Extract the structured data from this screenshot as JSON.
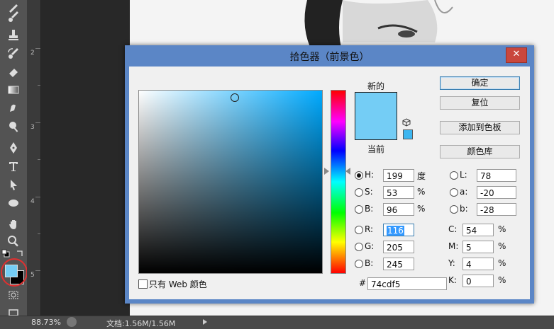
{
  "dialog": {
    "title": "拾色器（前景色）",
    "close_label": "✕",
    "labels": {
      "new": "新的",
      "current": "当前"
    },
    "buttons": {
      "ok": "确定",
      "reset": "复位",
      "add_swatch": "添加到色板",
      "libraries": "颜色库"
    },
    "hsb": {
      "h": {
        "label": "H:",
        "value": "199",
        "unit": "度"
      },
      "s": {
        "label": "S:",
        "value": "53",
        "unit": "%"
      },
      "b": {
        "label": "B:",
        "value": "96",
        "unit": "%"
      }
    },
    "rgb": {
      "r": {
        "label": "R:",
        "value": "116"
      },
      "g": {
        "label": "G:",
        "value": "205"
      },
      "b": {
        "label": "B:",
        "value": "245"
      }
    },
    "lab": {
      "l": {
        "label": "L:",
        "value": "78"
      },
      "a": {
        "label": "a:",
        "value": "-20"
      },
      "b": {
        "label": "b:",
        "value": "-28"
      }
    },
    "cmyk": {
      "c": {
        "label": "C:",
        "value": "54",
        "unit": "%"
      },
      "m": {
        "label": "M:",
        "value": "5",
        "unit": "%"
      },
      "y": {
        "label": "Y:",
        "value": "4",
        "unit": "%"
      },
      "k": {
        "label": "K:",
        "value": "0",
        "unit": "%"
      }
    },
    "hex": {
      "label": "#",
      "value": "74cdf5"
    },
    "web_only_label": "只有 Web 颜色"
  },
  "ruler": {
    "marks": [
      "2",
      "3",
      "4",
      "5"
    ]
  },
  "statusbar": {
    "zoom": "88.73%",
    "doc_info": "文档:1.56M/1.56M"
  },
  "colors": {
    "foreground": "#74cdf5",
    "background": "#000000",
    "accent": "#5b86c6"
  }
}
